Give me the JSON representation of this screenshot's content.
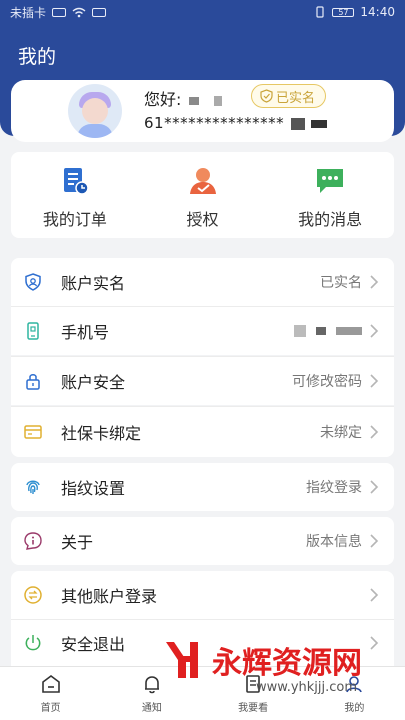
{
  "status_bar": {
    "carrier": "未插卡",
    "time": "14:40",
    "battery": "57"
  },
  "header": {
    "title": "我的"
  },
  "profile": {
    "greeting": "您好:",
    "badge": "已实名",
    "phone_masked": "61***************"
  },
  "shortcuts": [
    {
      "label": "我的订单",
      "icon": "orders-icon"
    },
    {
      "label": "授权",
      "icon": "authorize-icon"
    },
    {
      "label": "我的消息",
      "icon": "messages-icon"
    }
  ],
  "menu": {
    "account_realname": {
      "label": "账户实名",
      "value": "已实名"
    },
    "phone": {
      "label": "手机号",
      "value": ""
    },
    "account_security": {
      "label": "账户安全",
      "value": "可修改密码"
    },
    "social_card": {
      "label": "社保卡绑定",
      "value": "未绑定"
    },
    "fingerprint": {
      "label": "指纹设置",
      "value": "指纹登录"
    },
    "about": {
      "label": "关于",
      "value": "版本信息"
    },
    "other_login": {
      "label": "其他账户登录",
      "value": ""
    },
    "logout": {
      "label": "安全退出",
      "value": ""
    }
  },
  "tabbar": [
    {
      "label": "首页",
      "icon": "home-icon"
    },
    {
      "label": "通知",
      "icon": "bell-icon"
    },
    {
      "label": "我要看",
      "icon": "doc-icon"
    },
    {
      "label": "我的",
      "icon": "user-icon"
    }
  ],
  "watermark": {
    "text": "永辉资源网",
    "url": "www.yhkjjj.com"
  },
  "colors": {
    "brand": "#2a4a9a",
    "badge": "#c9a43a"
  }
}
